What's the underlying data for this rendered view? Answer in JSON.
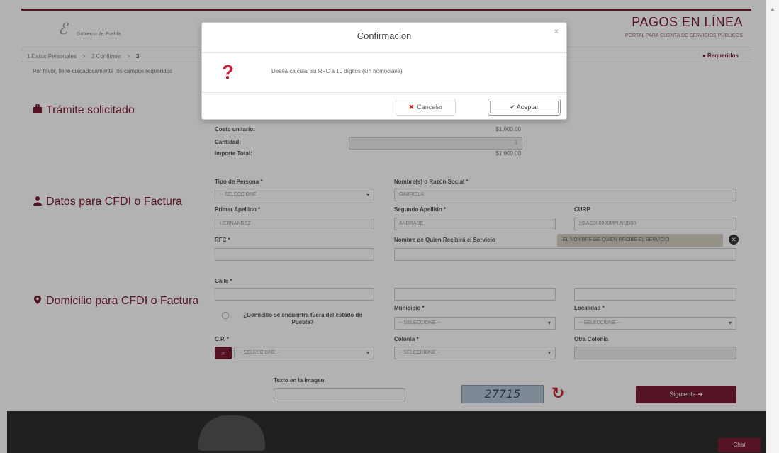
{
  "header": {
    "logo_text": "Gobierno de Puebla",
    "title": "PAGOS EN LÍNEA",
    "subtitle": "PORTAL PARA CUENTA DE SERVICIOS PÚBLICOS"
  },
  "breadcrumbs": [
    "1 Datos Personales",
    "2 Confirmar",
    "3"
  ],
  "breadcrumb_sep": ">",
  "required_note": "● Requeridos",
  "instructions": "Por favor, llene cuidadosamente los campos requeridos",
  "sections": {
    "tramite": "Trámite solicitado",
    "cfdi": "Datos para CFDI o Factura",
    "domicilio": "Domicilio para CFDI o Factura"
  },
  "tramite": {
    "costo_label": "Costo unitario:",
    "costo_value": "$1,000.00",
    "cantidad_label": "Cantidad:",
    "cantidad_value": "1",
    "importe_label": "Importe Total:",
    "importe_value": "$1,000.00"
  },
  "cfdi": {
    "tipo_persona_label": "Tipo de Persona *",
    "tipo_persona_value": "-- SELECCIONE --",
    "nombre_label": "Nombre(s) o Razón Social *",
    "nombre_value": "GABRIELA",
    "primer_apellido_label": "Primer Apellido *",
    "primer_apellido_value": "HERNANDEZ",
    "segundo_apellido_label": "Segundo Apellido *",
    "segundo_apellido_value": "ANDRADE",
    "curp_label": "CURP",
    "curp_value": "HEAG000000MPLNNB00",
    "rfc_label": "RFC *",
    "rfc_value": "",
    "quien_recibe_label": "Nombre de Quien Recibirá el Servicio",
    "quien_recibe_tag": "EL NOMBRE DE QUIEN RECIBE EL SERVICIO"
  },
  "domicilio": {
    "calle_label": "Calle *",
    "fuera_label": "¿Domicilio se encuentra fuera del estado de Puebla?",
    "municipio_label": "Municipio *",
    "municipio_value": "-- SELECCIONE --",
    "localidad_label": "Localidad *",
    "localidad_value": "-- SELECCIONE --",
    "cp_label": "C.P. *",
    "cp_value": "-- SELECCIONE --",
    "colonia_label": "Colonia *",
    "colonia_value": "-- SELECCIONE --",
    "otra_colonia_label": "Otra Colonia"
  },
  "captcha": {
    "label": "Texto en la Imagen",
    "code": "27715"
  },
  "next_button": "Siguiente ➔",
  "chat_button": "Chat",
  "modal": {
    "title": "Confirmacion",
    "message": "Desea calcular su RFC a 10 dígitos (sin homoclave)",
    "cancel": "Cancelar",
    "ok": "✔ Aceptar"
  },
  "colors": {
    "brand": "#7b1c34",
    "question": "#c41f3b"
  }
}
